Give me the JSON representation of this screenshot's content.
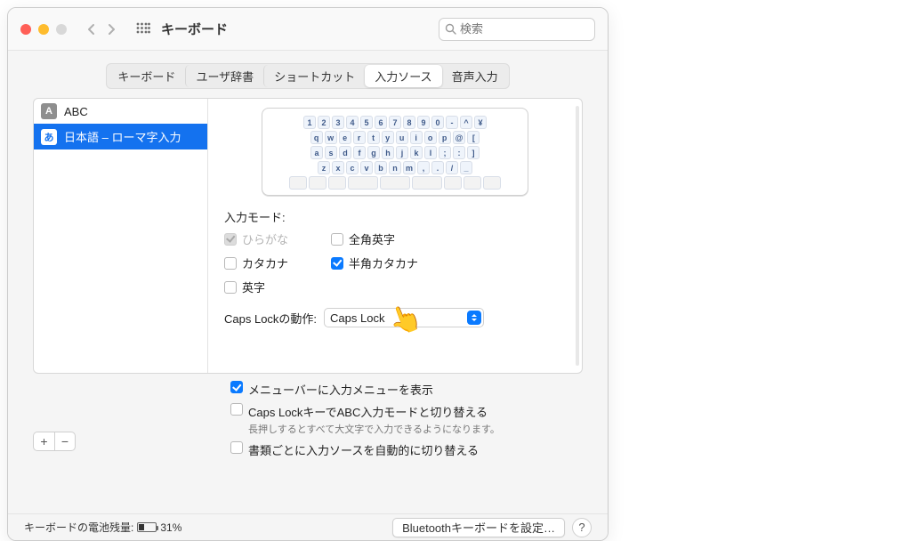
{
  "header": {
    "title": "キーボード",
    "search_placeholder": "検索"
  },
  "tabs": [
    "キーボード",
    "ユーザ辞書",
    "ショートカット",
    "入力ソース",
    "音声入力"
  ],
  "active_tab_index": 3,
  "sources": [
    {
      "badge": "A",
      "label": "ABC",
      "badge_class": "a"
    },
    {
      "badge": "あ",
      "label": "日本語 – ローマ字入力",
      "badge_class": "j"
    }
  ],
  "selected_source_index": 1,
  "keyboard_rows": [
    [
      "1",
      "2",
      "3",
      "4",
      "5",
      "6",
      "7",
      "8",
      "9",
      "0",
      "-",
      "^",
      "¥"
    ],
    [
      "q",
      "w",
      "e",
      "r",
      "t",
      "y",
      "u",
      "i",
      "o",
      "p",
      "@",
      "["
    ],
    [
      "a",
      "s",
      "d",
      "f",
      "g",
      "h",
      "j",
      "k",
      "l",
      ";",
      ":",
      "]"
    ],
    [
      "z",
      "x",
      "c",
      "v",
      "b",
      "n",
      "m",
      ",",
      ".",
      "/",
      "_"
    ]
  ],
  "input_modes_label": "入力モード:",
  "modes": {
    "hiragana": {
      "label": "ひらがな",
      "checked": true,
      "disabled": true
    },
    "katakana": {
      "label": "カタカナ",
      "checked": false,
      "disabled": false
    },
    "eiji": {
      "label": "英字",
      "checked": false,
      "disabled": false
    },
    "zen_eisu": {
      "label": "全角英字",
      "checked": false,
      "disabled": false
    },
    "han_kata": {
      "label": "半角カタカナ",
      "checked": true,
      "disabled": false
    }
  },
  "caps_lock": {
    "label": "Caps Lockの動作:",
    "value": "Caps Lock"
  },
  "global": {
    "show_menu": {
      "label": "メニューバーに入力メニューを表示",
      "checked": true
    },
    "caps_switch": {
      "label": "Caps LockキーでABC入力モードと切り替える",
      "checked": false,
      "hint": "長押しするとすべて大文字で入力できるようになります。"
    },
    "auto_switch": {
      "label": "書類ごとに入力ソースを自動的に切り替える",
      "checked": false
    }
  },
  "footer": {
    "battery_label": "キーボードの電池残量:",
    "battery_pct": "31%",
    "bluetooth_btn": "Bluetoothキーボードを設定…",
    "help": "?"
  }
}
